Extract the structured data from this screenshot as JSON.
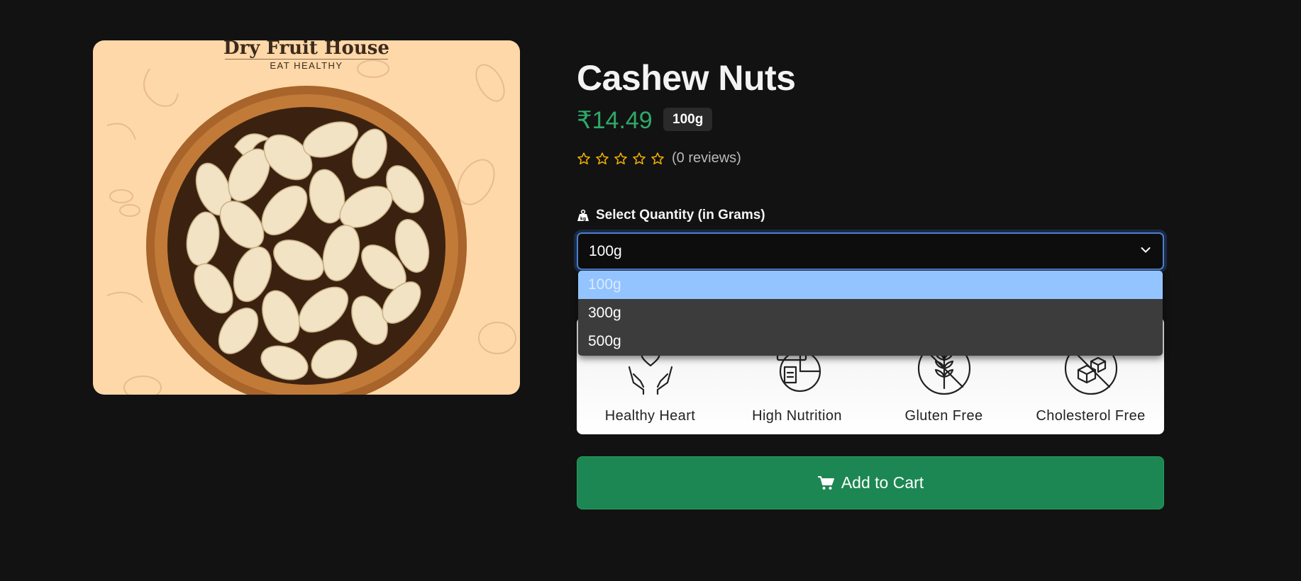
{
  "product": {
    "brand_name": "Dry Fruit House",
    "brand_tagline": "EAT HEALTHY",
    "title": "Cashew Nuts",
    "price": "₹14.49",
    "weight_badge": "100g",
    "rating": 0,
    "reviews_text": "(0 reviews)"
  },
  "quantity": {
    "label": "Select Quantity (in Grams)",
    "selected": "100g",
    "options": [
      "100g",
      "300g",
      "500g"
    ]
  },
  "features": [
    {
      "label": "Healthy Heart",
      "icon": "heart-hands-icon"
    },
    {
      "label": "High Nutrition",
      "icon": "nutrition-chart-icon"
    },
    {
      "label": "Gluten Free",
      "icon": "gluten-free-icon"
    },
    {
      "label": "Cholesterol Free",
      "icon": "cholesterol-free-icon"
    }
  ],
  "cart": {
    "label": "Add to Cart",
    "icon": "cart-icon"
  },
  "colors": {
    "background": "#121212",
    "price_green": "#2fa86a",
    "cart_green": "#1c8752",
    "star": "#f5b301",
    "option_highlight": "#93c4ff",
    "image_bg": "#fed8a8"
  }
}
